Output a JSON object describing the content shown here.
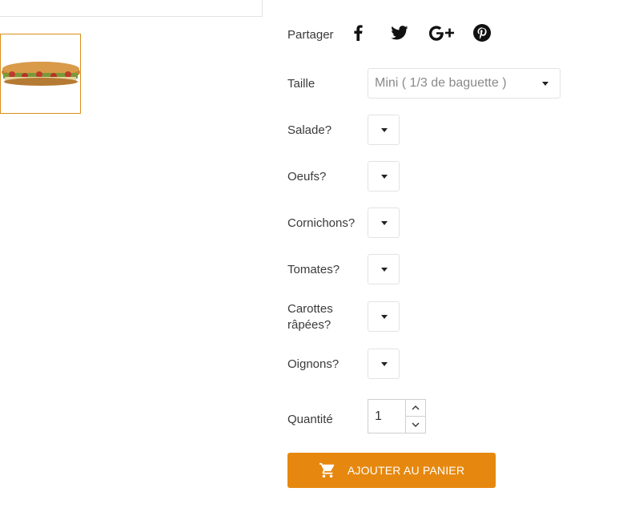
{
  "share": {
    "label": "Partager",
    "icons": [
      "facebook-icon",
      "twitter-icon",
      "google-plus-icon",
      "pinterest-icon"
    ]
  },
  "options": {
    "size": {
      "label": "Taille",
      "value": "Mini ( 1/3 de baguette )"
    },
    "salad": {
      "label": "Salade?"
    },
    "eggs": {
      "label": "Oeufs?"
    },
    "pickles": {
      "label": "Cornichons?"
    },
    "tomatoes": {
      "label": "Tomates?"
    },
    "carrots": {
      "label_line1": "Carottes",
      "label_line2": "râpées?"
    },
    "onions": {
      "label": "Oignons?"
    }
  },
  "quantity": {
    "label": "Quantité",
    "value": "1"
  },
  "cart": {
    "button_label": "AJOUTER AU PANIER",
    "icon": "cart-icon"
  },
  "colors": {
    "accent": "#e6880f",
    "thumb_border": "#d98e1b"
  }
}
